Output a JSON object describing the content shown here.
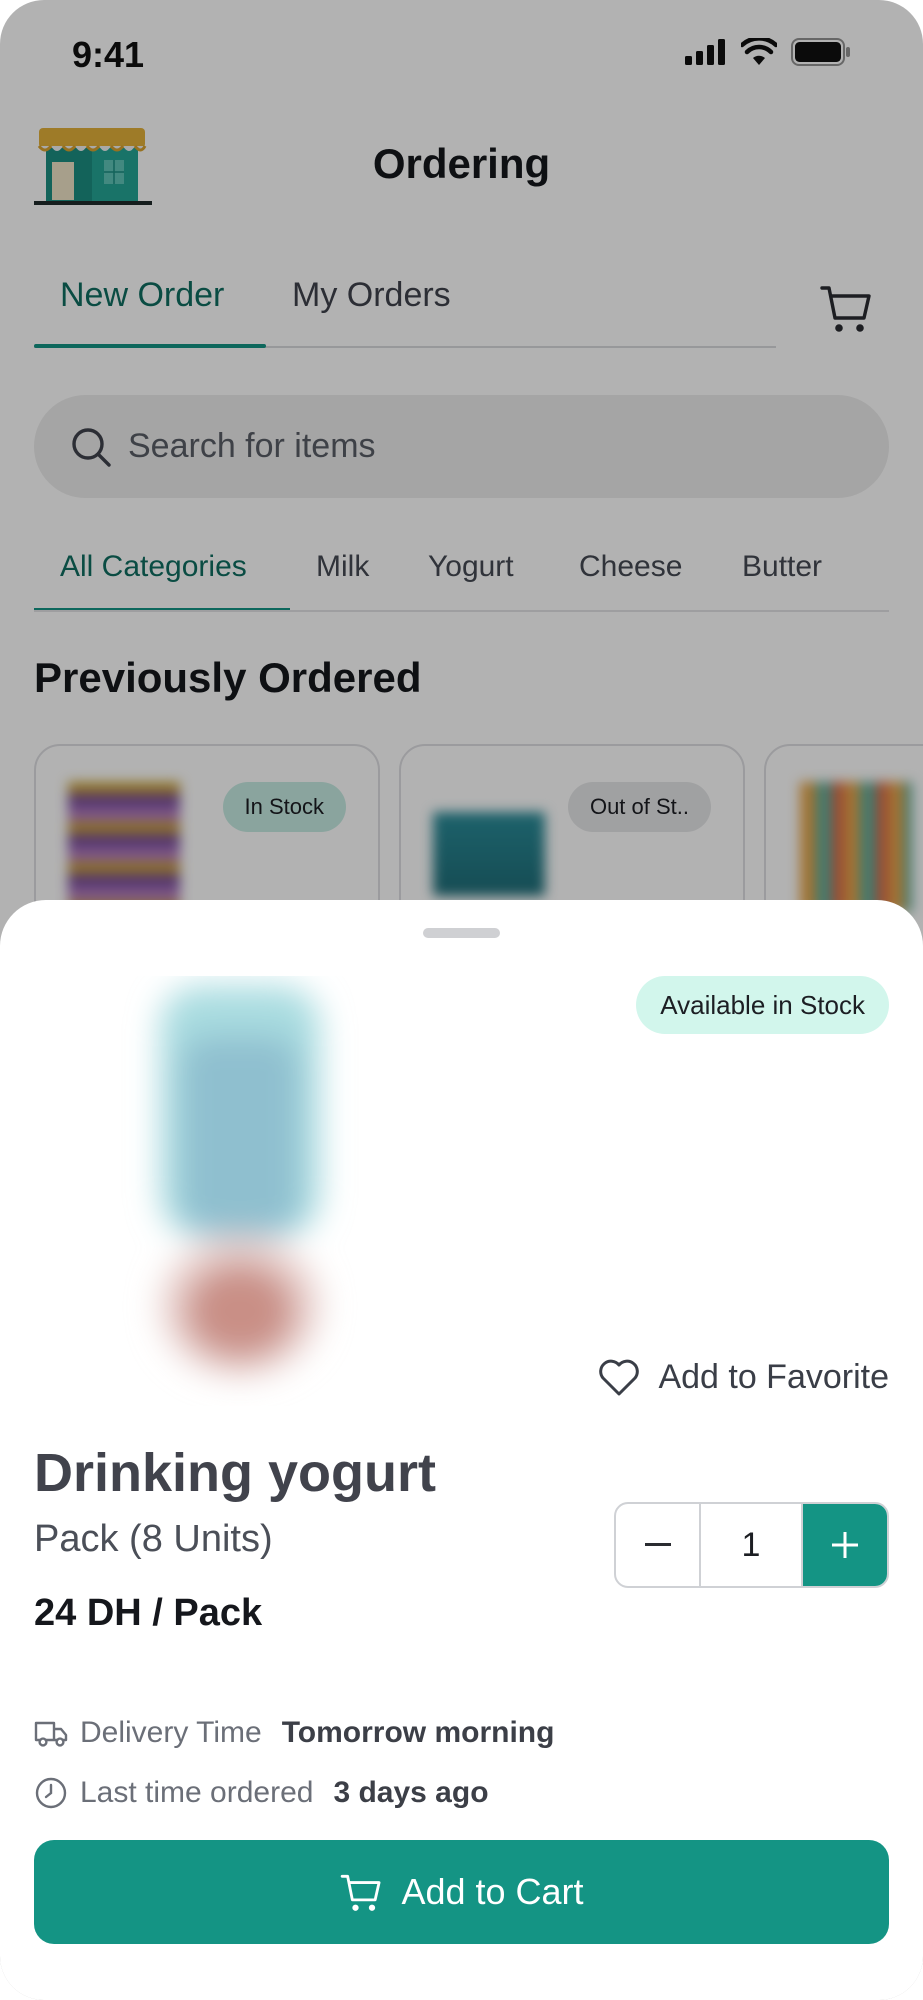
{
  "status_bar": {
    "time": "9:41"
  },
  "header": {
    "title": "Ordering"
  },
  "main_tabs": [
    {
      "label": "New Order",
      "active": true
    },
    {
      "label": "My Orders",
      "active": false
    }
  ],
  "search": {
    "placeholder": "Search for items"
  },
  "categories": [
    {
      "label": "All Categories",
      "active": true
    },
    {
      "label": "Milk"
    },
    {
      "label": "Yogurt"
    },
    {
      "label": "Cheese"
    },
    {
      "label": "Butter"
    }
  ],
  "previously_ordered": {
    "title": "Previously Ordered",
    "items": [
      {
        "badge": "In Stock",
        "badge_color": "#c6ebe2"
      },
      {
        "badge": "Out of St..",
        "badge_color": "#e6e7e9"
      },
      {
        "badge": ""
      }
    ]
  },
  "detail": {
    "stock_badge": "Available in Stock",
    "favorite_label": "Add to Favorite",
    "name": "Drinking yogurt",
    "pack": "Pack (8 Units)",
    "price": "24 DH / Pack",
    "quantity": "1",
    "delivery_label": "Delivery Time",
    "delivery_value": "Tomorrow morning",
    "last_ordered_label": "Last time ordered",
    "last_ordered_value": "3 days ago",
    "add_to_cart": "Add to Cart"
  },
  "colors": {
    "accent": "#149484",
    "accent_text": "#0f6e61",
    "stock_bg": "#d2f6ec"
  }
}
